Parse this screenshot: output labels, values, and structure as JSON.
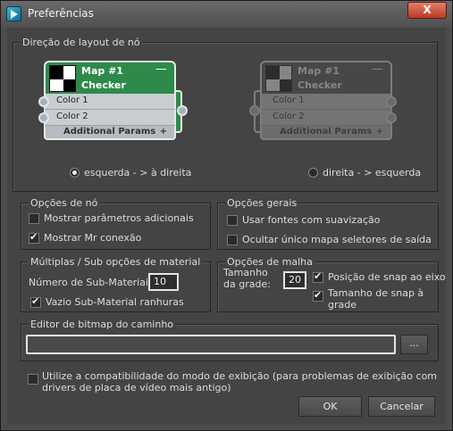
{
  "window": {
    "title": "Preferências",
    "close_label": "X"
  },
  "layout_group": {
    "legend": "Direção de layout de nó",
    "node": {
      "title": "Map #1",
      "subtitle": "Checker",
      "collapse": "—",
      "inputs": [
        "Color 1",
        "Color 2"
      ],
      "footer": "Additional Params",
      "footer_plus": "+"
    },
    "option_left": "esquerda - > à direita",
    "option_right": "direita - > esquerda",
    "selected": "left"
  },
  "node_options": {
    "legend": "Opções de nó",
    "show_params": "Mostrar parâmetros adicionais",
    "show_params_checked": false,
    "show_mr": "Mostrar Mr conexão",
    "show_mr_checked": true
  },
  "general_options": {
    "legend": "Opções gerais",
    "smooth_fonts": "Usar fontes com suavização",
    "smooth_fonts_checked": false,
    "hide_single": "Ocultar único mapa seletores de saída",
    "hide_single_checked": false
  },
  "multi_sub": {
    "legend": "Múltiplas / Sub opções de material",
    "count_label": "Número de Sub-Materiais:",
    "count_value": "10",
    "empty_slots": "Vazio Sub-Material ranhuras",
    "empty_slots_checked": true
  },
  "grid_options": {
    "legend": "Opções de malha",
    "size_label": "Tamanho da grade:",
    "size_value": "20",
    "snap_pos": "Posição de snap ao eixo",
    "snap_pos_checked": true,
    "snap_size": "Tamanho de snap à grade",
    "snap_size_checked": true
  },
  "bitmap_editor": {
    "legend": "Editor de bitmap do caminho",
    "path_value": "",
    "browse_label": "..."
  },
  "compat": {
    "label": "Utilize a compatibilidade do modo de exibição (para problemas de exibição com drivers de placa de vídeo mais antigo)",
    "checked": false
  },
  "buttons": {
    "ok": "OK",
    "cancel": "Cancelar"
  }
}
